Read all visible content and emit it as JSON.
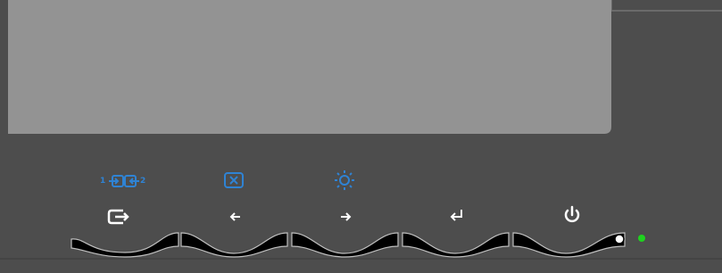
{
  "monitor": {
    "input_select_numbers": {
      "left": "1",
      "right": "2"
    },
    "colors": {
      "bezel": "#4d4d4d",
      "screen": "#939393",
      "secondary_icon_blue": "#2f83d4",
      "primary_icon_white": "#ffffff",
      "button_strip": "#000000",
      "power_led": "#1fd21f"
    },
    "buttons": [
      {
        "id": "input",
        "primary_icon": "input-source-icon",
        "secondary_icon": "input-switch-icon"
      },
      {
        "id": "left",
        "primary_icon": "arrow-left-icon",
        "secondary_icon": "auto-adjust-icon"
      },
      {
        "id": "right",
        "primary_icon": "arrow-right-icon",
        "secondary_icon": "brightness-icon"
      },
      {
        "id": "enter",
        "primary_icon": "enter-icon",
        "secondary_icon": ""
      },
      {
        "id": "power",
        "primary_icon": "power-icon",
        "secondary_icon": ""
      }
    ],
    "power_led_state": "on"
  }
}
